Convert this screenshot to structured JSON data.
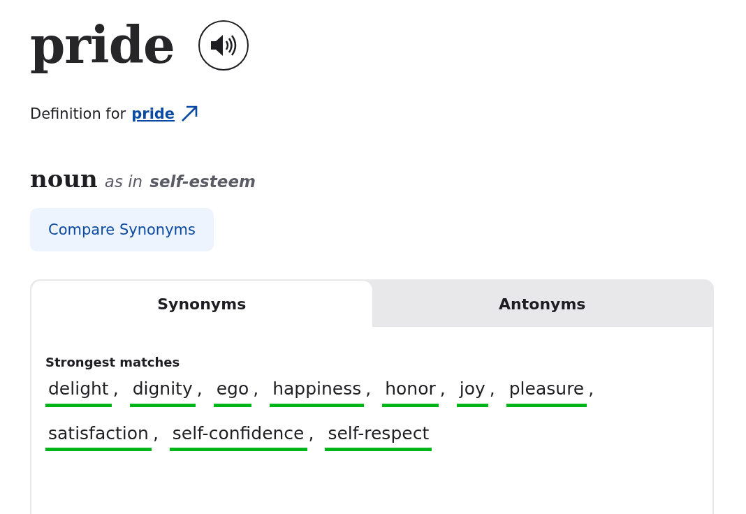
{
  "headword": "pride",
  "definition": {
    "prefix": "Definition for",
    "link": "pride"
  },
  "sense": {
    "part_of_speech": "noun",
    "as_in": "as in",
    "meaning": "self-esteem"
  },
  "compare_button": "Compare Synonyms",
  "tabs": [
    {
      "label": "Synonyms",
      "selected": true
    },
    {
      "label": "Antonyms",
      "selected": false
    }
  ],
  "section_title": "Strongest matches",
  "words": [
    {
      "text": "delight",
      "separator": ","
    },
    {
      "text": "dignity",
      "separator": ","
    },
    {
      "text": "ego",
      "separator": ","
    },
    {
      "text": "happiness",
      "separator": ","
    },
    {
      "text": "honor",
      "separator": ","
    },
    {
      "text": "joy",
      "separator": ","
    },
    {
      "text": "pleasure",
      "separator": ","
    },
    {
      "text": "satisfaction",
      "separator": ","
    },
    {
      "text": "self-confidence",
      "separator": ","
    },
    {
      "text": "self-respect"
    }
  ]
}
